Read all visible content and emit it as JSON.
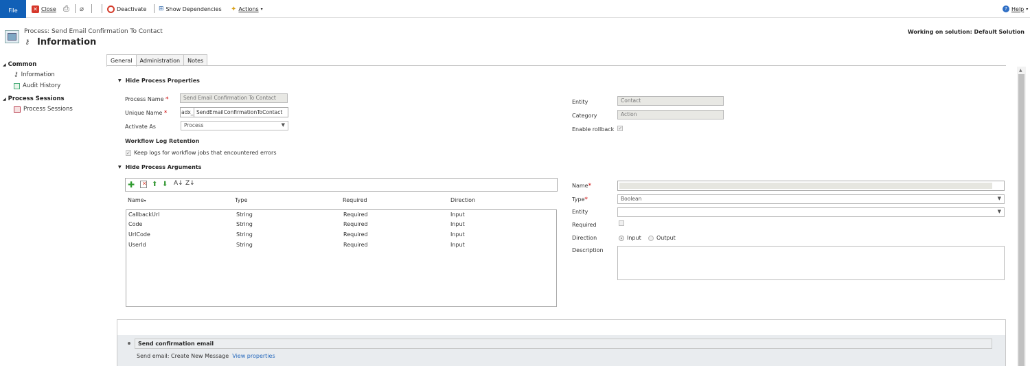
{
  "toolbar": {
    "file": "File",
    "close": "Close",
    "deactivate": "Deactivate",
    "show_dependencies": "Show Dependencies",
    "actions": "Actions",
    "help": "Help"
  },
  "header": {
    "subtitle": "Process: Send Email Confirmation To Contact",
    "title": "Information",
    "solution": "Working on solution: Default Solution"
  },
  "nav": {
    "common": "Common",
    "information": "Information",
    "audit_history": "Audit History",
    "process_sessions_group": "Process Sessions",
    "process_sessions": "Process Sessions"
  },
  "tabs": [
    "General",
    "Administration",
    "Notes"
  ],
  "properties": {
    "section_title": "Hide Process Properties",
    "process_name_label": "Process Name",
    "process_name_value": "Send Email Confirmation To Contact",
    "unique_name_label": "Unique Name",
    "unique_name_prefix": "adx_",
    "unique_name_value": "SendEmailConfirmationToContact",
    "activate_as_label": "Activate As",
    "activate_as_value": "Process",
    "log_retention_title": "Workflow Log Retention",
    "keep_logs_label": "Keep logs for workflow jobs that encountered errors",
    "entity_label": "Entity",
    "entity_value": "Contact",
    "category_label": "Category",
    "category_value": "Action",
    "enable_rollback_label": "Enable rollback"
  },
  "arguments": {
    "section_title": "Hide Process Arguments",
    "columns": [
      "Name",
      "Type",
      "Required",
      "Direction"
    ],
    "rows": [
      {
        "name": "CallbackUrl",
        "type": "String",
        "required": "Required",
        "direction": "Input"
      },
      {
        "name": "Code",
        "type": "String",
        "required": "Required",
        "direction": "Input"
      },
      {
        "name": "UrlCode",
        "type": "String",
        "required": "Required",
        "direction": "Input"
      },
      {
        "name": "UserId",
        "type": "String",
        "required": "Required",
        "direction": "Input"
      }
    ],
    "name_label": "Name",
    "type_label": "Type",
    "type_value": "Boolean",
    "entity_label": "Entity",
    "required_label": "Required",
    "direction_label": "Direction",
    "direction_input": "Input",
    "direction_output": "Output",
    "description_label": "Description"
  },
  "steps": {
    "step_title": "Send confirmation email",
    "step_desc": "Send email:  Create New Message",
    "view_properties": "View properties"
  },
  "colors": {
    "file_button": "#1160b7",
    "required_star": "#cc0000",
    "link": "#2266bb"
  }
}
